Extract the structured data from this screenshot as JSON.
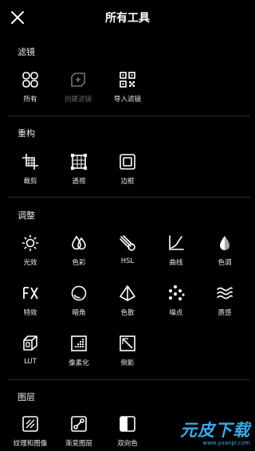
{
  "header": {
    "title": "所有工具",
    "close_icon": "close-icon"
  },
  "sections": {
    "filters": {
      "title": "滤镜",
      "items": [
        {
          "label": "所有",
          "icon": "grid-filters-icon",
          "enabled": true
        },
        {
          "label": "创建滤镜",
          "icon": "create-filter-icon",
          "enabled": false
        },
        {
          "label": "导入滤镜",
          "icon": "qr-import-icon",
          "enabled": true
        }
      ]
    },
    "composition": {
      "title": "重构",
      "items": [
        {
          "label": "裁剪",
          "icon": "crop-icon"
        },
        {
          "label": "透视",
          "icon": "perspective-icon"
        },
        {
          "label": "边框",
          "icon": "border-frame-icon"
        }
      ]
    },
    "adjust": {
      "title": "调整",
      "items": [
        {
          "label": "光效",
          "icon": "sun-icon"
        },
        {
          "label": "色彩",
          "icon": "color-drops-icon"
        },
        {
          "label": "HSL",
          "icon": "hsl-icon"
        },
        {
          "label": "曲线",
          "icon": "curve-icon"
        },
        {
          "label": "色调",
          "icon": "tone-drop-icon"
        },
        {
          "label": "特效",
          "icon": "fx-icon"
        },
        {
          "label": "暗角",
          "icon": "vignette-icon"
        },
        {
          "label": "色散",
          "icon": "prism-icon"
        },
        {
          "label": "噪点",
          "icon": "noise-icon"
        },
        {
          "label": "质感",
          "icon": "texture-waves-icon"
        },
        {
          "label": "LUT",
          "icon": "lut-cube-icon"
        },
        {
          "label": "像素化",
          "icon": "pixelate-icon"
        },
        {
          "label": "倒影",
          "icon": "reflection-icon"
        }
      ]
    },
    "layers": {
      "title": "图层",
      "items": [
        {
          "label": "纹理和图像",
          "icon": "texture-image-icon"
        },
        {
          "label": "渐变图层",
          "icon": "gradient-layer-icon"
        },
        {
          "label": "双向色",
          "icon": "duotone-icon"
        }
      ]
    }
  },
  "watermark": {
    "brand": "元皮下载",
    "url": "www.yuanpi.com"
  },
  "colors": {
    "background": "#000000",
    "text": "#ffffff",
    "disabled": "#6b6b6b",
    "watermark": "#3fa8e8"
  }
}
